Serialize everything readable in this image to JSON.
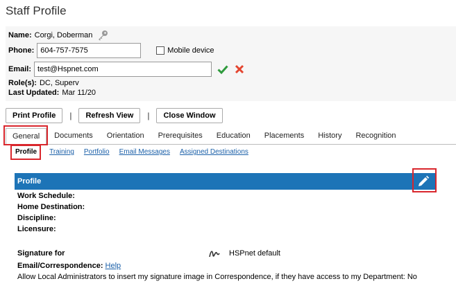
{
  "page": {
    "title": "Staff Profile"
  },
  "profile": {
    "name_label": "Name:",
    "name_value": "Corgi, Doberman",
    "phone_label": "Phone:",
    "phone_value": "604-757-7575",
    "mobile_label": "Mobile device",
    "email_label": "Email:",
    "email_value": "test@Hspnet.com",
    "roles_label": "Role(s):",
    "roles_value": "DC, Superv",
    "updated_label": "Last Updated:",
    "updated_value": "Mar 11/20"
  },
  "toolbar": {
    "print_label": "Print Profile",
    "refresh_label": "Refresh View",
    "close_label": "Close Window",
    "separator": "|"
  },
  "tabs": [
    {
      "label": "General"
    },
    {
      "label": "Documents"
    },
    {
      "label": "Orientation"
    },
    {
      "label": "Prerequisites"
    },
    {
      "label": "Education"
    },
    {
      "label": "Placements"
    },
    {
      "label": "History"
    },
    {
      "label": "Recognition"
    }
  ],
  "subtabs": [
    {
      "label": "Profile"
    },
    {
      "label": "Training"
    },
    {
      "label": "Portfolio"
    },
    {
      "label": "Email Messages"
    },
    {
      "label": "Assigned Destinations"
    }
  ],
  "section": {
    "title": "Profile"
  },
  "fields": {
    "work_schedule": "Work Schedule:",
    "home_destination": "Home Destination:",
    "discipline": "Discipline:",
    "licensure": "Licensure:",
    "signature_for": "Signature for",
    "email_correspondence": "Email/Correspondence:",
    "help_link": "Help",
    "signature_default": "HSPnet default",
    "allow_admins_text": "Allow Local Administrators to insert my signature image in Correspondence, if they have access to my Department: No"
  },
  "colors": {
    "section_bar": "#1d74b7",
    "highlight": "#d9262c",
    "link": "#1a5fa8",
    "check": "#2e9a3c",
    "cancel": "#e4452f"
  }
}
